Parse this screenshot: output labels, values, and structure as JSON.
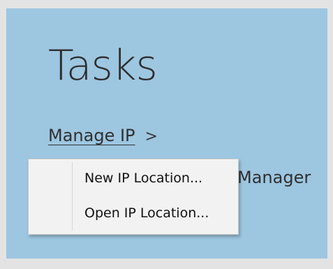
{
  "tasks": {
    "title": "Tasks",
    "links": [
      {
        "label": "Manage IP",
        "chevron": ">"
      },
      {
        "label": "Manager",
        "chevron": ">"
      }
    ]
  },
  "context_menu": {
    "items": [
      {
        "label": "New IP Location..."
      },
      {
        "label": "Open IP Location..."
      }
    ]
  },
  "colors": {
    "panel_bg": "#9dc6e0",
    "page_bg": "#e3e3e3",
    "menu_bg": "#f2f2f2"
  }
}
